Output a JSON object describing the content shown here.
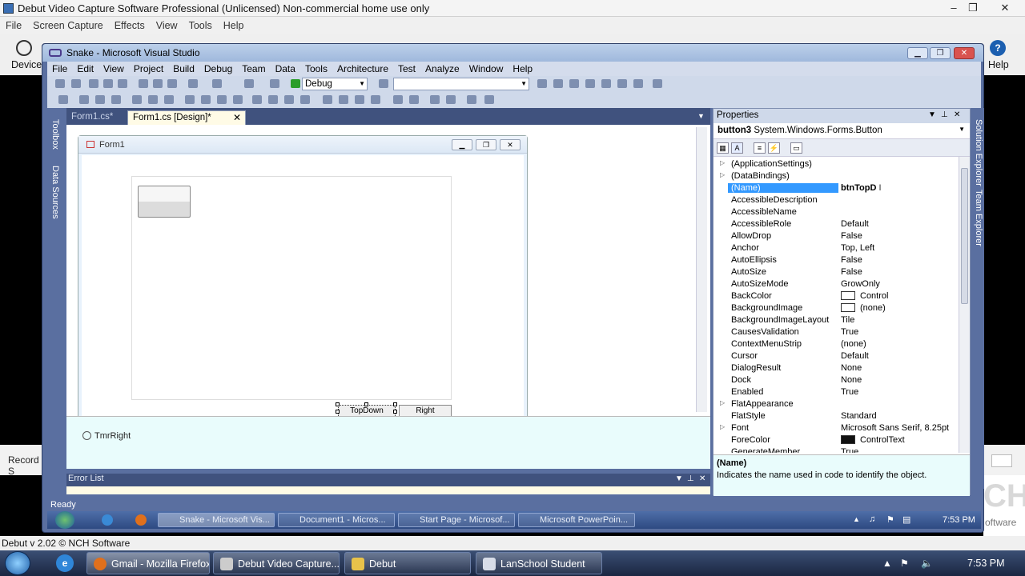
{
  "debut": {
    "title": "Debut Video Capture Software Professional (Unlicensed) Non-commercial home use only",
    "menu": [
      "File",
      "Screen Capture",
      "Effects",
      "View",
      "Tools",
      "Help"
    ],
    "toolbar": {
      "devices_label": "Device",
      "help_label": "Help"
    },
    "record_label": "Record S",
    "status": "Debut v 2.02 © NCH Software",
    "watermark": {
      "letters": "CH",
      "software": "oftware"
    }
  },
  "vs": {
    "title": "Snake - Microsoft Visual Studio",
    "menu": [
      "File",
      "Edit",
      "View",
      "Project",
      "Build",
      "Debug",
      "Team",
      "Data",
      "Tools",
      "Architecture",
      "Test",
      "Analyze",
      "Window",
      "Help"
    ],
    "config": "Debug",
    "toolbox_strip": [
      "Toolbox",
      "Data Sources"
    ],
    "right_strip": [
      "Solution Explorer",
      "Team Explorer"
    ],
    "tabs": [
      {
        "label": "Form1.cs*"
      },
      {
        "label": "Form1.cs [Design]*"
      }
    ],
    "form": {
      "title": "Form1",
      "btn_topdown": "TopDown",
      "btn_right": "Right"
    },
    "tray_component": "TmrRight",
    "error_list": {
      "title": "Error List"
    },
    "status": "Ready",
    "properties": {
      "title": "Properties",
      "object_name": "button3",
      "object_type": "System.Windows.Forms.Button",
      "rows": [
        {
          "name": "(ApplicationSettings)",
          "value": "",
          "expand": true
        },
        {
          "name": "(DataBindings)",
          "value": "",
          "expand": true
        },
        {
          "name": "(Name)",
          "value": "btnTopD",
          "selected": true
        },
        {
          "name": "AccessibleDescription",
          "value": ""
        },
        {
          "name": "AccessibleName",
          "value": ""
        },
        {
          "name": "AccessibleRole",
          "value": "Default"
        },
        {
          "name": "AllowDrop",
          "value": "False"
        },
        {
          "name": "Anchor",
          "value": "Top, Left"
        },
        {
          "name": "AutoEllipsis",
          "value": "False"
        },
        {
          "name": "AutoSize",
          "value": "False"
        },
        {
          "name": "AutoSizeMode",
          "value": "GrowOnly"
        },
        {
          "name": "BackColor",
          "value": "Control",
          "swatch": "white"
        },
        {
          "name": "BackgroundImage",
          "value": "(none)",
          "swatch": "white"
        },
        {
          "name": "BackgroundImageLayout",
          "value": "Tile"
        },
        {
          "name": "CausesValidation",
          "value": "True"
        },
        {
          "name": "ContextMenuStrip",
          "value": "(none)"
        },
        {
          "name": "Cursor",
          "value": "Default"
        },
        {
          "name": "DialogResult",
          "value": "None"
        },
        {
          "name": "Dock",
          "value": "None"
        },
        {
          "name": "Enabled",
          "value": "True"
        },
        {
          "name": "FlatAppearance",
          "value": "",
          "expand": true
        },
        {
          "name": "FlatStyle",
          "value": "Standard"
        },
        {
          "name": "Font",
          "value": "Microsoft Sans Serif, 8.25pt",
          "expand": true
        },
        {
          "name": "ForeColor",
          "value": "ControlText",
          "swatch": "black"
        },
        {
          "name": "GenerateMember",
          "value": "True"
        }
      ],
      "desc_title": "(Name)",
      "desc_text": "Indicates the name used in code to identify the object."
    },
    "inner_taskbar": {
      "items": [
        "Snake - Microsoft Vis...",
        "Document1 - Micros...",
        "Start Page - Microsof...",
        "Microsoft PowerPoin..."
      ],
      "clock": "7:53 PM"
    }
  },
  "taskbar": {
    "items": [
      "Gmail - Mozilla Firefox",
      "Debut Video Capture...",
      "Debut",
      "LanSchool Student"
    ],
    "clock": "7:53 PM"
  },
  "colors": {
    "selection": "#3399ff",
    "vs_frame": "#5a6fa0",
    "tray_bg": "#e9fcfc"
  }
}
